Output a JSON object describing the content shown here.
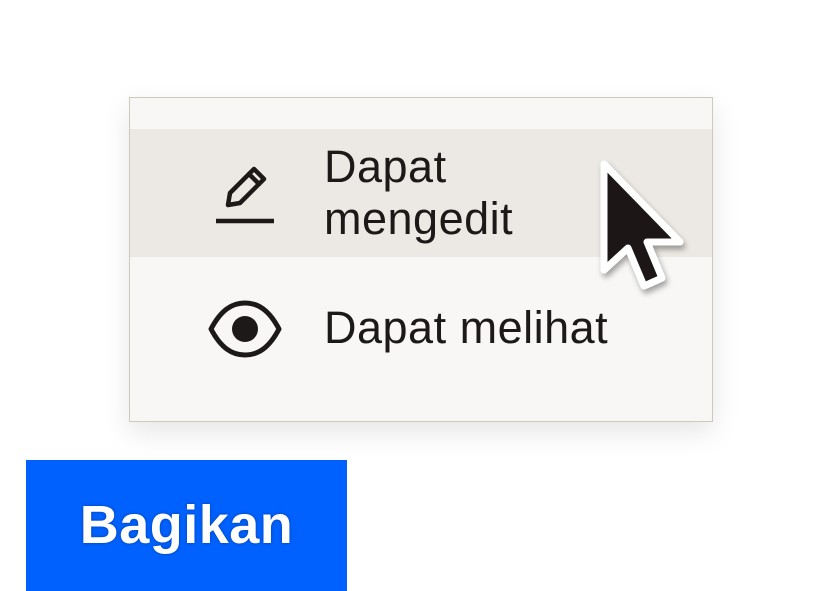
{
  "menu": {
    "items": [
      {
        "label_line1": "Dapat",
        "label_line2": "mengedit",
        "icon": "pencil-icon",
        "highlighted": true
      },
      {
        "label": "Dapat melihat",
        "icon": "eye-icon",
        "highlighted": false
      }
    ]
  },
  "share_button": {
    "label": "Bagikan"
  },
  "colors": {
    "button_bg": "#0061fe",
    "button_text": "#ffffff",
    "menu_bg": "#f8f7f5",
    "menu_hover_bg": "#ece9e4",
    "text": "#1e1919",
    "menu_border": "#cfc9bd"
  },
  "cursor": {
    "icon": "mouse-pointer-icon"
  }
}
